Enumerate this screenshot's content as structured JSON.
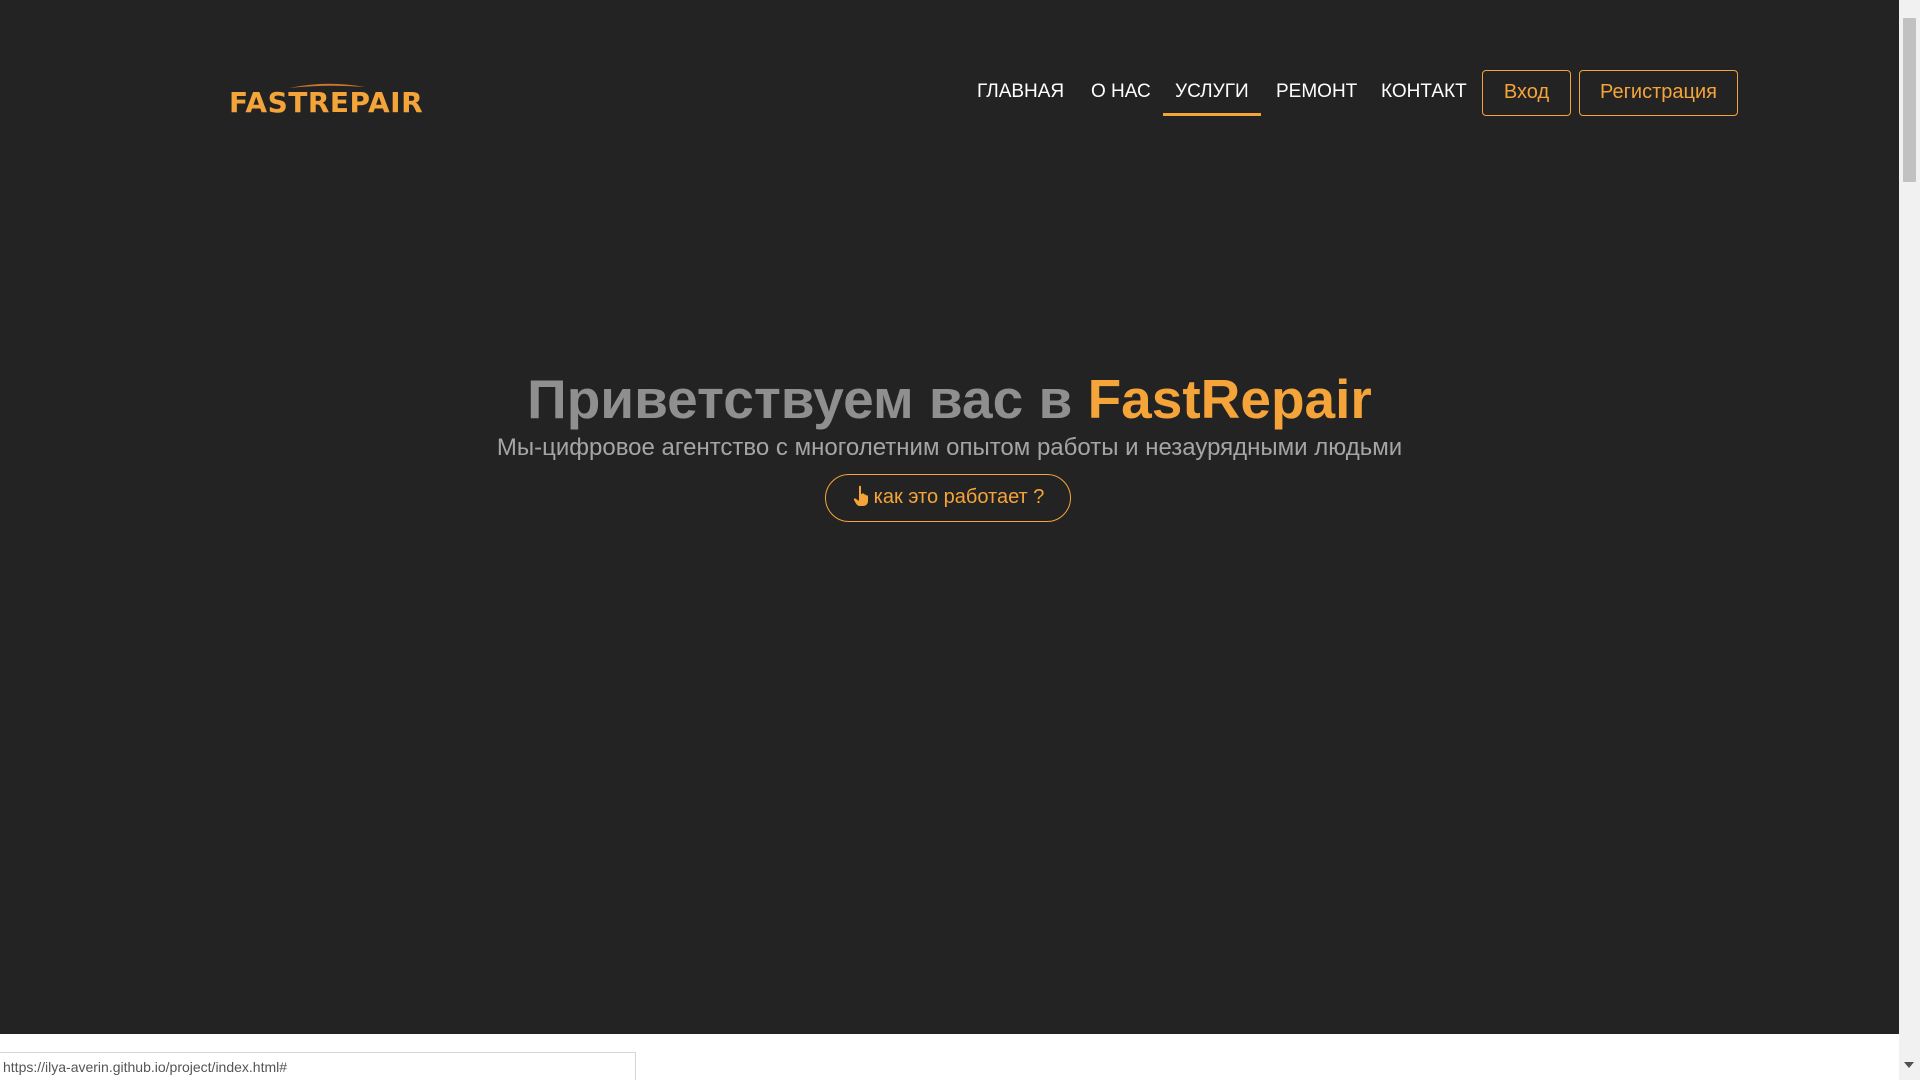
{
  "brand": {
    "logo_text": "FASTREPAIR",
    "accent_color": "#f5a43a",
    "background_color": "#232323"
  },
  "nav": {
    "items": [
      {
        "label": "ГЛАВНАЯ",
        "active": false
      },
      {
        "label": "О НАС",
        "active": false
      },
      {
        "label": "УСЛУГИ",
        "active": true
      },
      {
        "label": "РЕМОНТ",
        "active": false
      },
      {
        "label": "КОНТАКТ",
        "active": false
      }
    ],
    "login_label": "Вход",
    "register_label": "Регистрация"
  },
  "hero": {
    "title_prefix": "Приветствуем вас в ",
    "title_brand": "FastRepair",
    "subtitle": "Мы-цифровое агентство с многолетним опытом работы и незаурядными людьми",
    "cta_label": "как это работает ?",
    "cta_icon": "pointing-hand-icon"
  },
  "status_bar": {
    "url": "https://ilya-averin.github.io/project/index.html#"
  }
}
